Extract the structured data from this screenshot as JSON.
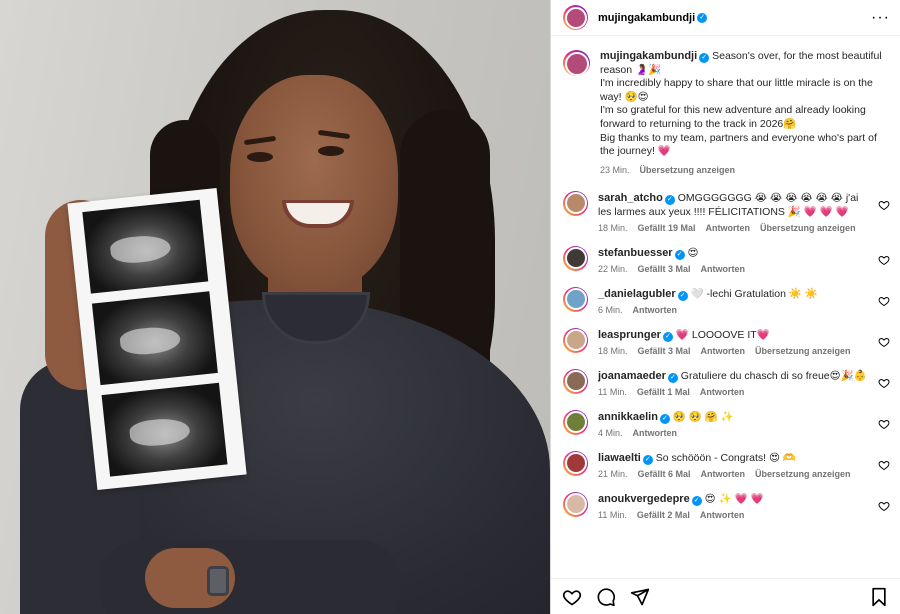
{
  "post": {
    "author": "mujingakambundji",
    "caption": {
      "line1": "Season's over, for the most beautiful reason 🤰🏽🎉",
      "line2": "I'm incredibly happy to share that our little miracle is on the way! 🥺😍",
      "line3": "I'm so grateful for this new adventure and already looking forward to returning to the track in 2026🤗",
      "line4": "Big thanks to my team, partners and everyone who's part of the journey! 💗"
    },
    "time": "23 Min.",
    "translate": "Übersetzung anzeigen"
  },
  "labels": {
    "reply": "Antworten",
    "translate": "Übersetzung anzeigen"
  },
  "comments": [
    {
      "user": "sarah_atcho",
      "text": "OMGGGGGGG 😭 😭 😭 😭 😭 😭 j'ai les larmes aux yeux !!!! FÉLICITATIONS 🎉 💗 💗 💗",
      "time": "18 Min.",
      "likes": "Gefällt 19 Mal",
      "translate": true,
      "avatar_color": "#b98a6a"
    },
    {
      "user": "stefanbuesser",
      "text": "😍",
      "time": "22 Min.",
      "likes": "Gefällt 3 Mal",
      "translate": false,
      "avatar_color": "#3e3a36"
    },
    {
      "user": "_danielagubler",
      "text": "🤍 -lechi Gratulation ☀️ ☀️",
      "time": "6 Min.",
      "likes": "",
      "translate": false,
      "avatar_color": "#6fa3c7"
    },
    {
      "user": "leasprunger",
      "text": "💗 LOOOOVE IT💗",
      "time": "18 Min.",
      "likes": "Gefällt 3 Mal",
      "translate": true,
      "avatar_color": "#c9a58a"
    },
    {
      "user": "joanamaeder",
      "text": "Gratuliere du chasch di so freue😍🎉👶",
      "time": "11 Min.",
      "likes": "Gefällt 1 Mal",
      "translate": false,
      "avatar_color": "#8a6a55"
    },
    {
      "user": "annikkaelin",
      "text": "🥺 🥺 🤗 ✨",
      "time": "4 Min.",
      "likes": "",
      "translate": false,
      "avatar_color": "#6f7f3a"
    },
    {
      "user": "liawaelti",
      "text": "So schööön - Congrats! 😍 🫶",
      "time": "21 Min.",
      "likes": "Gefällt 6 Mal",
      "translate": true,
      "avatar_color": "#a03a3a"
    },
    {
      "user": "anoukvergedepre",
      "text": "😍 ✨ 💗 💗",
      "time": "11 Min.",
      "likes": "Gefällt 2 Mal",
      "translate": false,
      "avatar_color": "#d8b9a5"
    }
  ],
  "icons": {
    "more": "more-options-icon",
    "like": "heart-icon",
    "comment": "comment-icon",
    "share": "share-icon",
    "save": "bookmark-icon",
    "verified": "verified-badge-icon"
  },
  "colors": {
    "accent": "#0095f6",
    "muted": "#737373",
    "border": "#dbdbdb"
  }
}
